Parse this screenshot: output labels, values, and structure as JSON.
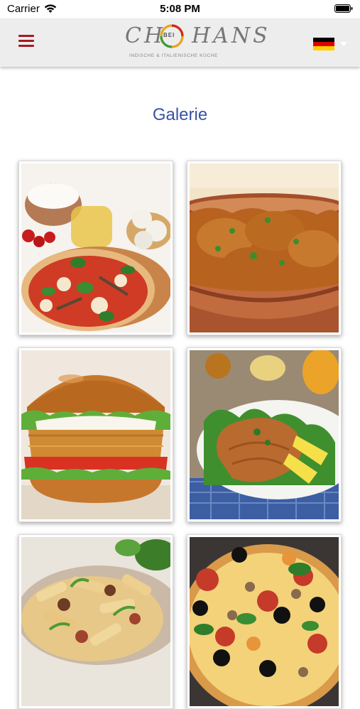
{
  "status_bar": {
    "carrier": "Carrier",
    "time": "5:08 PM"
  },
  "header": {
    "logo_left": "CH",
    "logo_bei": "BEI",
    "logo_right": "HANS",
    "logo_subtitle": "INDISCHE & ITALIENISCHE KÜCHE",
    "language_flag": "german-flag"
  },
  "page": {
    "title": "Galerie"
  },
  "gallery": [
    {
      "name": "pizza-margherita-photo"
    },
    {
      "name": "chicken-curry-pot-photo"
    },
    {
      "name": "chicken-burger-photo"
    },
    {
      "name": "schnitzel-salad-photo"
    },
    {
      "name": "penne-pasta-photo"
    },
    {
      "name": "pizza-olives-photo"
    }
  ],
  "colors": {
    "accent": "#a31b22",
    "title": "#3a54a3",
    "navbar": "#ededed"
  }
}
